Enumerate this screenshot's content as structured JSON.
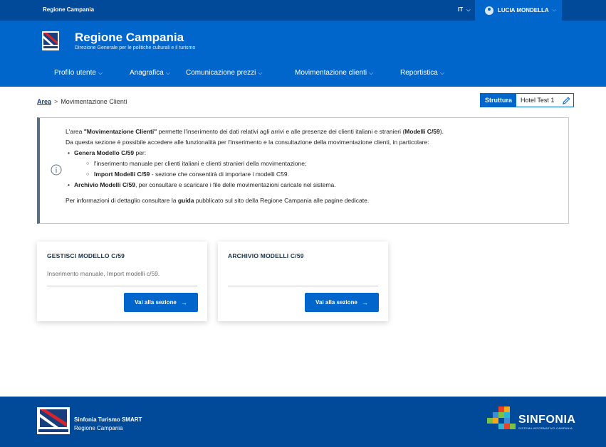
{
  "topbar": {
    "brand": "Regione Campania",
    "language": "IT",
    "user_name": "LUCIA MONDELLA"
  },
  "header": {
    "title": "Regione Campania",
    "subtitle": "Direzione Generale per le politiche culturali e il turismo",
    "nav": [
      {
        "label": "Profilo utente"
      },
      {
        "label": "Anagrafica"
      },
      {
        "label": "Comunicazione prezzi"
      },
      {
        "label": "Movimentazione clienti"
      },
      {
        "label": "Reportistica"
      }
    ]
  },
  "breadcrumb": {
    "root": "Area",
    "separator": ">",
    "current": "Movimentazione Clienti"
  },
  "struttura": {
    "label": "Struttura",
    "value": "Hotel Test 1"
  },
  "info": {
    "p1_a": "L'area ",
    "p1_b": "\"Movimentazione Clienti\"",
    "p1_c": " permette l'inserimento dei dati relativi agli arrivi e alle presenze dei clienti italiani e stranieri (",
    "p1_d": "Modelli C/59",
    "p1_e": ").",
    "p2": "Da questa sezione è possibile accedere alle funzionalità per l'inserimento e la consultazione della movimentazione clienti, in particolare:",
    "b1_bold": "Genera Modello C/59",
    "b1_rest": " per:",
    "b1a": "l'inserimento manuale per clienti italiani e clienti stranieri della movimentazione;",
    "b1b_bold": "Import Modelli C/59",
    "b1b_rest": " - sezione che consentirà di importare i modelli C59.",
    "b2_bold": "Archivio Modelli C/59",
    "b2_rest": ", per consultare e scaricare i file delle movimentazioni caricate nel sistema.",
    "p3_a": "Per informazioni di dettaglio consultare la ",
    "p3_b": "guida",
    "p3_c": " pubblicato sul sito della Regione Campania alle pagine dedicate."
  },
  "cards": [
    {
      "title": "GESTISCI MODELLO C/59",
      "description": "Inserimento manuale, Import modelli c/59.",
      "button": "Vai alla sezione"
    },
    {
      "title": "ARCHIVIO MODELLI C/59",
      "description": "",
      "button": "Vai alla sezione"
    }
  ],
  "footer": {
    "title": "Sinfonia Turismo SMART",
    "subtitle": "Regione Campania",
    "brand_name": "SINFONIA",
    "brand_sub": "SISTEMA INFORMATIVO CAMPANIA"
  },
  "colors": {
    "primary": "#0066cc",
    "dark_primary": "#004a99",
    "heading": "#17324d"
  }
}
